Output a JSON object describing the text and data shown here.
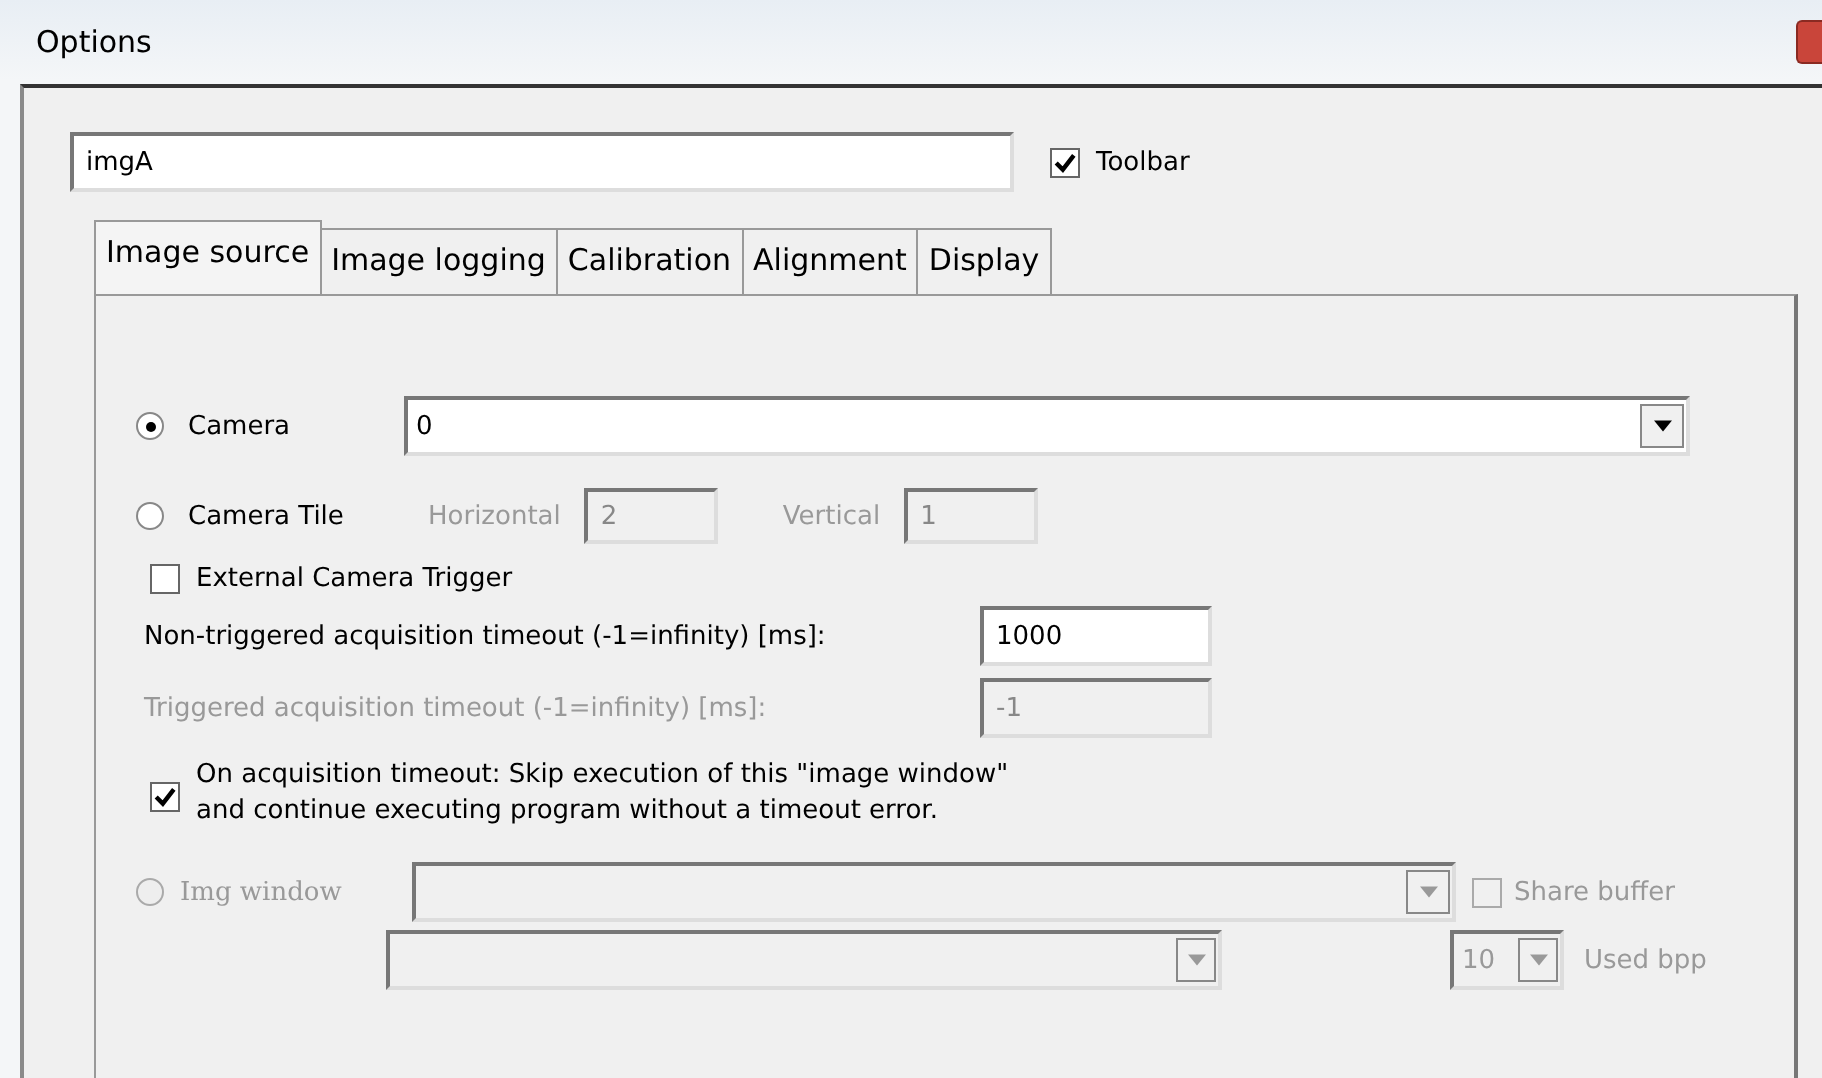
{
  "window": {
    "title": "Options"
  },
  "name_field": {
    "value": "imgA"
  },
  "toolbar": {
    "label": "Toolbar",
    "checked": true
  },
  "tabs": [
    {
      "label": "Image source",
      "selected": true
    },
    {
      "label": "Image logging",
      "selected": false
    },
    {
      "label": "Calibration",
      "selected": false
    },
    {
      "label": "Alignment",
      "selected": false
    },
    {
      "label": "Display",
      "selected": false
    }
  ],
  "camera": {
    "label": "Camera",
    "selected": true,
    "value": "0",
    "disabled": false
  },
  "camera_tile": {
    "label": "Camera Tile",
    "selected": false,
    "disabled": true,
    "horizontal_label": "Horizontal",
    "horizontal": "2",
    "vertical_label": "Vertical",
    "vertical": "1"
  },
  "external_trigger": {
    "label": "External Camera Trigger",
    "checked": false
  },
  "timeouts": [
    {
      "label": "Non-triggered acquisition timeout (-1=infinity) [ms]:",
      "value": "1000",
      "disabled": false
    },
    {
      "label": "Triggered acquisition timeout (-1=infinity) [ms]:",
      "value": "-1",
      "disabled": true
    }
  ],
  "skip_on_timeout": {
    "label": "On acquisition timeout: Skip execution of this \"image window\" and continue executing program without a timeout error.",
    "checked": true
  },
  "img_window": {
    "label": "Img window",
    "selected": false,
    "disabled": true
  },
  "share_buffer": {
    "label": "Share buffer",
    "checked": false,
    "disabled": true
  },
  "used_bpp": {
    "value": "10",
    "label": "Used bpp",
    "disabled": true
  }
}
